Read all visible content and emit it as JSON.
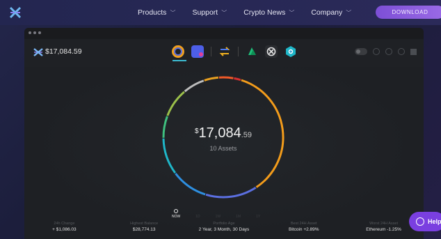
{
  "nav": {
    "logo_icon": "exodus-logo-icon",
    "items": [
      {
        "label": "Products"
      },
      {
        "label": "Support"
      },
      {
        "label": "Crypto News"
      },
      {
        "label": "Company"
      }
    ],
    "download_label": "DOWNLOAD"
  },
  "app": {
    "balance": "$17,084.59",
    "toolbar_icons": [
      "portfolio-icon",
      "wallet-icon",
      "exchange-icon",
      "apps-icon",
      "xo-icon",
      "shield-icon"
    ],
    "portfolio": {
      "currency": "$",
      "value_main": "17,084",
      "value_decimal": ".59",
      "assets_label": "10 Assets"
    },
    "timeline": [
      {
        "label": "NOW",
        "active": true
      },
      {
        "label": "1D",
        "active": false
      },
      {
        "label": "1W",
        "active": false
      },
      {
        "label": "1M",
        "active": false
      },
      {
        "label": "1Y",
        "active": false
      }
    ],
    "stats": [
      {
        "label": "24h Change",
        "value": "+ $1,086.03"
      },
      {
        "label": "Highest Balance",
        "value": "$28,774.13"
      },
      {
        "label": "Portfolio Age",
        "value": "2 Year, 3 Month, 30 Days"
      },
      {
        "label": "Best 24H Asset",
        "value": "Bitcoin +2.89%"
      },
      {
        "label": "Worst 24H Asset",
        "value": "Ethereum -1.25%"
      }
    ],
    "donut_segments": [
      {
        "color": "#f39c1b",
        "share": 0.36
      },
      {
        "color": "#5b6fe0",
        "share": 0.14
      },
      {
        "color": "#2e8fe0",
        "share": 0.1
      },
      {
        "color": "#1fb6c8",
        "share": 0.1
      },
      {
        "color": "#3fbf7f",
        "share": 0.06
      },
      {
        "color": "#9bc04a",
        "share": 0.08
      },
      {
        "color": "#bdbdbd",
        "share": 0.06
      },
      {
        "color": "#e8a020",
        "share": 0.04
      },
      {
        "color": "#f05a28",
        "share": 0.04
      },
      {
        "color": "#d63030",
        "share": 0.02
      }
    ]
  },
  "help": {
    "label": "Help"
  }
}
